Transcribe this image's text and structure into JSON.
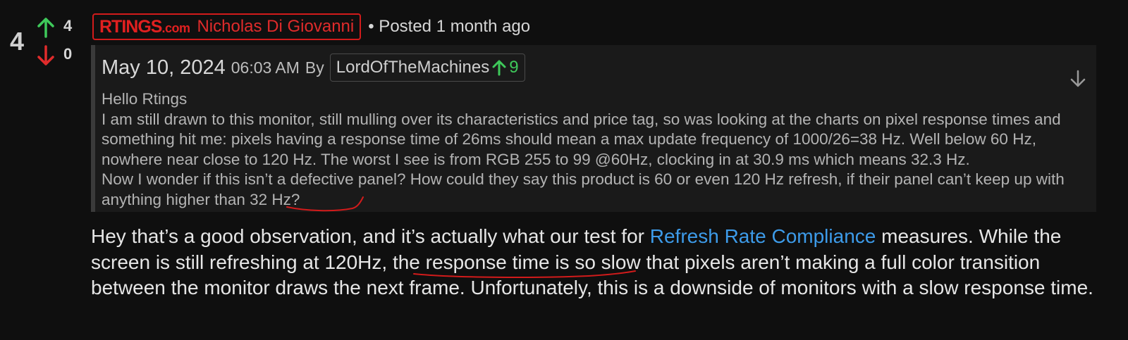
{
  "comment": {
    "score": "4",
    "upvotes": "4",
    "downvotes": "0",
    "brand": "RTINGS",
    "brand_suffix": ".com",
    "author": "Nicholas Di Giovanni",
    "posted": "• Posted 1 month ago"
  },
  "quote": {
    "date": "May 10, 2024",
    "time": "06:03 AM",
    "by": "By",
    "user": "LordOfTheMachines",
    "user_karma": "9",
    "lines": [
      "Hello Rtings",
      "I am still drawn to this monitor, still mulling over its characteristics and price tag, so was looking at the charts on pixel response times and something hit me: pixels having a response time of 26ms should mean a max update frequency of 1000/26=38 Hz. Well below 60 Hz, nowhere near close to 120 Hz. The worst I see is from RGB 255 to 99 @60Hz, clocking in at 30.9 ms which means 32.3 Hz.",
      "Now I wonder if this isn’t a defective panel? How could they say this product is 60 or even 120 Hz refresh, if their panel can’t keep up with anything higher than 32 Hz?"
    ]
  },
  "reply": {
    "part1": "Hey that’s a good observation, and it’s actually what our test for ",
    "link": "Refresh Rate Compliance",
    "part2": " measures. While the screen is still refreshing at 120Hz, the ",
    "highlight": "response time is so slow",
    "part3": " that pixels aren’t making a full color transition between the monitor draws the next frame. Unfortunately, this is a downside of monitors with a slow response time."
  },
  "colors": {
    "up": "#3ec95a",
    "down": "#e02b2b",
    "link": "#3d9be9",
    "brand": "#e12020"
  }
}
